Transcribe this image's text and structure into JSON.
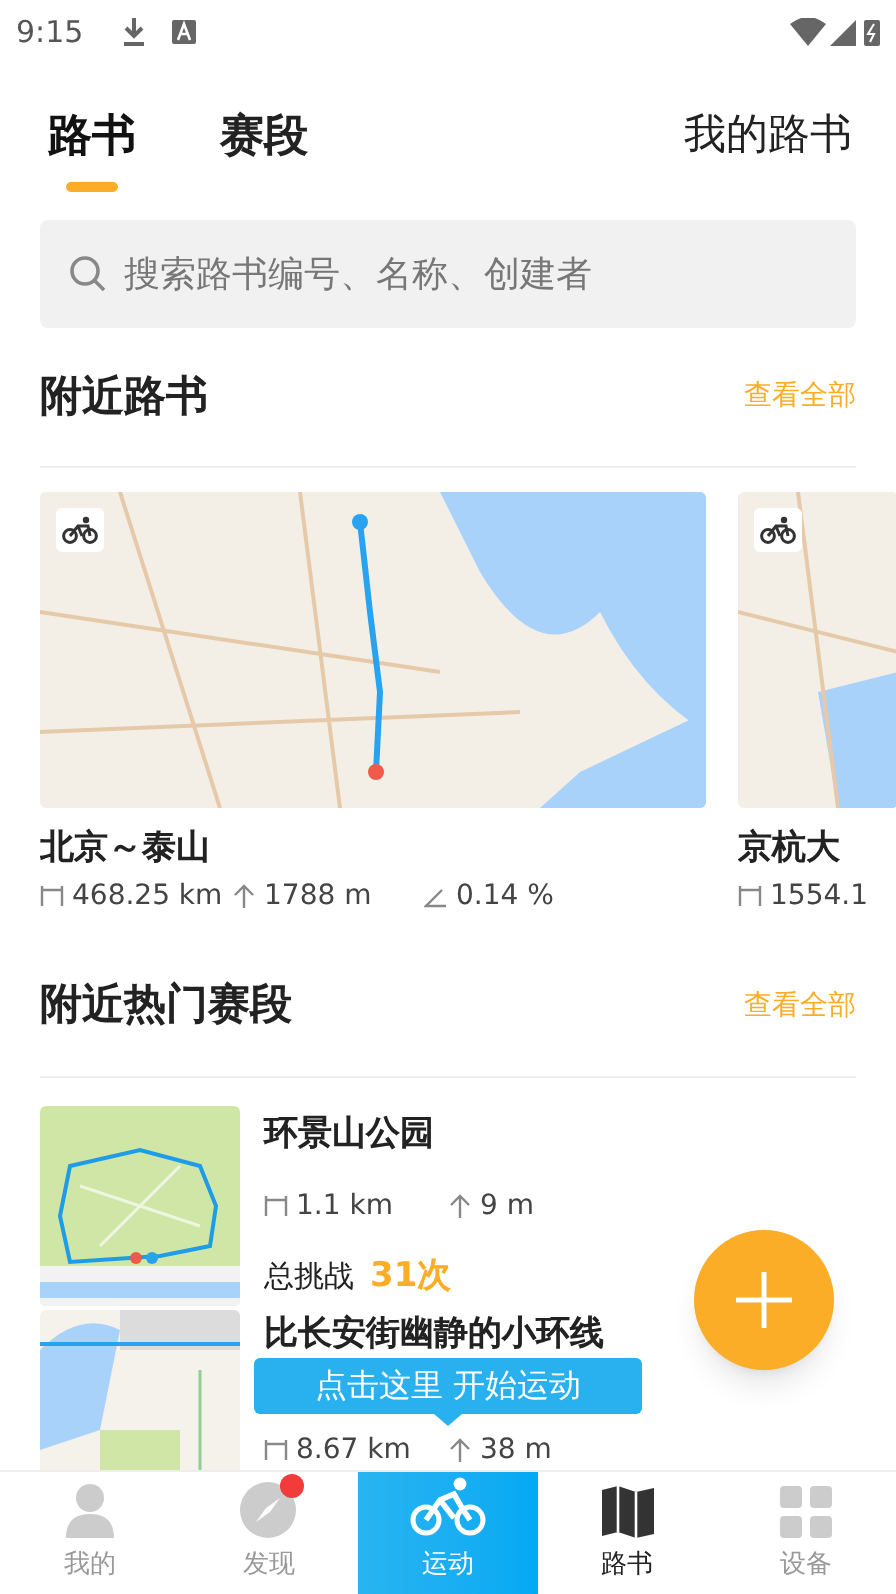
{
  "status_bar": {
    "time": "9:15"
  },
  "tabs": [
    {
      "label": "路书",
      "selected": true
    },
    {
      "label": "赛段",
      "selected": false
    }
  ],
  "my_routes_link": "我的路书",
  "search": {
    "placeholder": "搜索路书编号、名称、创建者"
  },
  "nearby_routes": {
    "title": "附近路书",
    "view_all": "查看全部",
    "cards": [
      {
        "title": "北京～泰山",
        "stats": [
          {
            "kind": "distance",
            "text": "468.25 km"
          },
          {
            "kind": "climb",
            "text": "1788 m"
          },
          {
            "kind": "grade",
            "text": "0.14 %"
          }
        ]
      },
      {
        "title": "京杭大",
        "stats": [
          {
            "kind": "distance",
            "text": "1554.1"
          }
        ]
      }
    ]
  },
  "nearby_segments": {
    "title": "附近热门赛段",
    "view_all": "查看全部",
    "items": [
      {
        "title": "环景山公园",
        "stats": [
          {
            "kind": "distance",
            "text": "1.1 km"
          },
          {
            "kind": "climb",
            "text": "9 m"
          }
        ],
        "challenges_label": "总挑战",
        "challenges": "31次"
      },
      {
        "title": "比长安街幽静的小环线",
        "stats": [
          {
            "kind": "distance",
            "text": "8.67 km"
          },
          {
            "kind": "climb",
            "text": "38 m"
          }
        ]
      }
    ]
  },
  "tooltip": "点击这里 开始运动",
  "bottom_nav": [
    {
      "label": "我的",
      "selected": false,
      "badge": false
    },
    {
      "label": "发现",
      "selected": false,
      "badge": true
    },
    {
      "label": "运动",
      "selected": true,
      "badge": false
    },
    {
      "label": "路书",
      "selected": false,
      "badge": false,
      "emphasized": true
    },
    {
      "label": "设备",
      "selected": false,
      "badge": false
    }
  ]
}
